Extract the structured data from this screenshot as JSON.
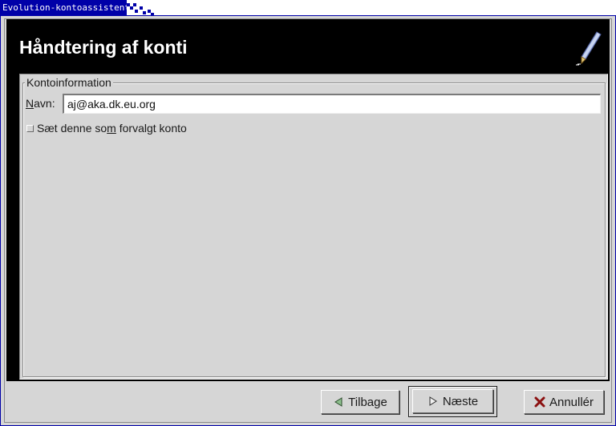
{
  "window": {
    "title": "Evolution-kontoassistent"
  },
  "header": {
    "title": "Håndtering af konti",
    "icon": "pen-icon"
  },
  "account_info": {
    "legend": "Kontoinformation",
    "name_label_accel": "N",
    "name_label_rest": "avn:",
    "name_value": "aj@aka.dk.eu.org",
    "default_checkbox": {
      "label_before": "Sæt denne so",
      "label_accel": "m",
      "label_after": " forvalgt konto",
      "checked": false
    }
  },
  "buttons": {
    "back": {
      "label": "Tilbage",
      "icon": "triangle-left-icon"
    },
    "next": {
      "label": "Næste",
      "icon": "triangle-right-icon"
    },
    "cancel": {
      "label": "Annullér",
      "icon": "close-x-icon"
    }
  },
  "colors": {
    "title_bar": "#0000a8",
    "header_bg": "#000000",
    "dialog_bg": "#d6d6d6",
    "cancel_icon": "#8b1010"
  }
}
